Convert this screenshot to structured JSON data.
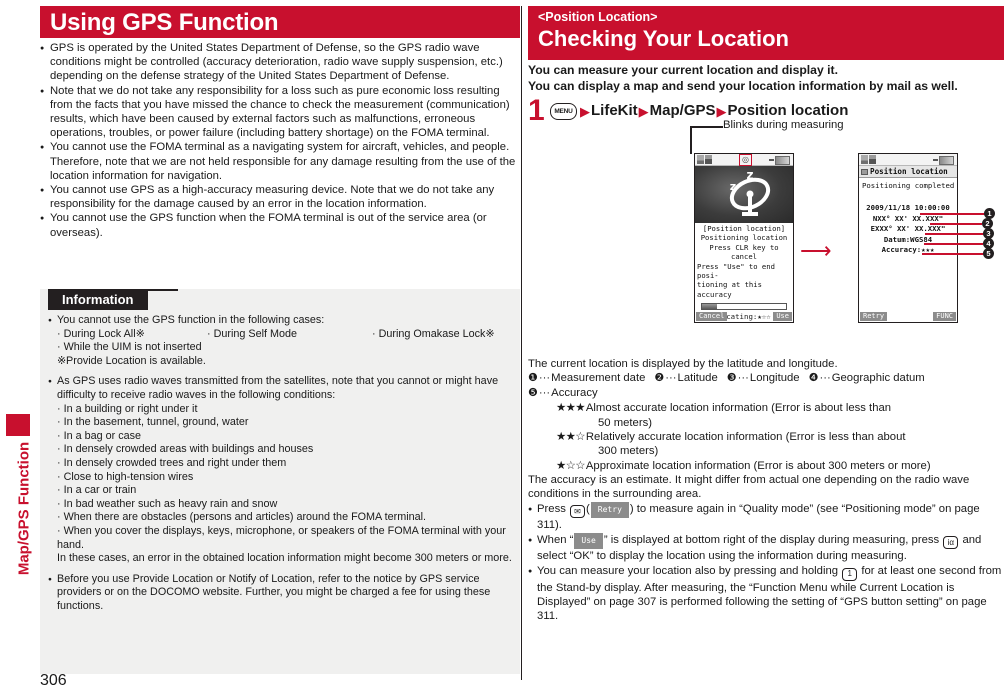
{
  "page": {
    "number": "306",
    "side_tab_label": "Map/GPS Function",
    "accent_color": "#c8102e",
    "info_header_color": "#231f20"
  },
  "left": {
    "title": "Using GPS Function",
    "bullets": [
      "GPS is operated by the United States Department of Defense, so the GPS radio wave conditions might be controlled (accuracy deterioration, radio wave supply suspension, etc.) depending on the defense strategy of the United States Department of Defense.",
      "Note that we do not take any responsibility for a loss such as pure economic loss resulting from the facts that you have missed the chance to check the measurement (communication) results, which have been caused by external factors such as malfunctions, erroneous operations, troubles, or power failure (including battery shortage) on the FOMA terminal.",
      "You cannot use the FOMA terminal as a navigating system for aircraft, vehicles, and people. Therefore, note that we are not held responsible for any damage resulting from the use of the location information for navigation.",
      "You cannot use GPS as a high-accuracy measuring device. Note that we do not take any responsibility for the damage caused by an error in the location information.",
      "You cannot use the GPS function when the FOMA terminal is out of the service area (or overseas)."
    ],
    "information": {
      "header": "Information",
      "bullet1": "You cannot use the GPS function in the following cases:",
      "lock_cases": [
        "· During Lock All※",
        "· During Self Mode",
        "· During Omakase Lock※"
      ],
      "case_uim": "· While the UIM is not inserted",
      "note_provide": "※Provide Location is available.",
      "bullet2": "As GPS uses radio waves transmitted from the satellites, note that you cannot or might have difficulty to receive radio waves in the following conditions:",
      "conditions": [
        "· In a building or right under it",
        "· In the basement, tunnel, ground, water",
        "· In a bag or case",
        "· In densely crowded areas with buildings and houses",
        "· In densely crowded trees and right under them",
        "· Close to high-tension wires",
        "· In a car or train",
        "· In bad weather such as heavy rain and snow",
        "· When there are obstacles (persons and articles) around the FOMA terminal.",
        "· When you cover the displays, keys, microphone, or speakers of the FOMA terminal with your hand."
      ],
      "conditions_note": "In these cases, an error in the obtained location information might become 300 meters or more.",
      "bullet3": "Before you use Provide Location or Notify of Location, refer to the notice by GPS service providers or on the DOCOMO website. Further, you might be charged a fee for using these functions."
    }
  },
  "right": {
    "banner_sub": "<Position Location>",
    "banner_title": "Checking Your Location",
    "intro_line1": "You can measure your current location and display it.",
    "intro_line2": "You can display a map and send your location information by mail as well.",
    "step": {
      "number": "1",
      "menu_key": "MENU",
      "item1": "LifeKit",
      "item2": "Map/GPS",
      "item3": "Position location",
      "arrow": "▶"
    },
    "blink_callout": "Blinks during measuring",
    "transition_arrow": "⟶",
    "phone1": {
      "line1": "[Position location]",
      "line2": "Positioning location",
      "line3": "Press CLR key to cancel",
      "line4": "Press \"Use\" to end posi-",
      "line5": "tioning at this accuracy",
      "locating_label": "Locating:",
      "locating_stars": "★☆☆",
      "softkey_left": "Cancel",
      "softkey_right": "Use",
      "progress_percent": "18"
    },
    "phone2": {
      "title": "Position location",
      "status": "Positioning completed",
      "date": "2009/11/18 10:00:00",
      "latitude": "NXX° XX' XX.XXX\"",
      "longitude": "EXXX° XX' XX.XXX\"",
      "datum": "Datum:WGS84",
      "accuracy_label": "Accuracy:",
      "accuracy_stars": "★★★",
      "softkey_left": "Retry",
      "softkey_right": "FUNC"
    },
    "callout_numbers": [
      "1",
      "2",
      "3",
      "4",
      "5"
    ],
    "lower": {
      "line_latlong": "The current location is displayed by the latitude and longitude.",
      "legend": [
        {
          "num": "❶",
          "text": "Measurement date"
        },
        {
          "num": "❷",
          "text": "Latitude"
        },
        {
          "num": "❸",
          "text": "Longitude"
        },
        {
          "num": "❹",
          "text": "Geographic datum"
        }
      ],
      "legend5_num": "❺",
      "legend5_text": "Accuracy",
      "accuracy_defs": [
        {
          "stars": "★★★",
          "text": "Almost accurate location information (Error is about less than",
          "cont": "50 meters)"
        },
        {
          "stars": "★★☆",
          "text": "Relatively accurate location information (Error is less than about",
          "cont": "300 meters)"
        },
        {
          "stars": "★☆☆",
          "text": "Approximate location information (Error is about 300 meters or more)",
          "cont": ""
        }
      ],
      "estimate_note": "The accuracy is an estimate. It might differ from actual one depending on the radio wave conditions in the surrounding area.",
      "bullet_press_pre": "Press",
      "bullet_press_key": "✉",
      "bullet_press_chip": "Retry",
      "bullet_press_post": ") to measure again in “Quality mode” (see “Positioning mode” on page 311).",
      "bullet_when_pre": "When “",
      "bullet_when_chip": "Use",
      "bullet_when_mid": "” is displayed at bottom right of the display during measuring, press",
      "bullet_when_key": "iα",
      "bullet_when_post": "and select “OK” to display the location using the information during measuring.",
      "bullet_hold_pre": "You can measure your location also by pressing and holding",
      "bullet_hold_key": "1",
      "bullet_hold_post": "for at least one second from the Stand-by display. After measuring, the “Function Menu while Current Location is Displayed” on page 307 is performed following the setting of “GPS button setting” on page 311."
    }
  }
}
